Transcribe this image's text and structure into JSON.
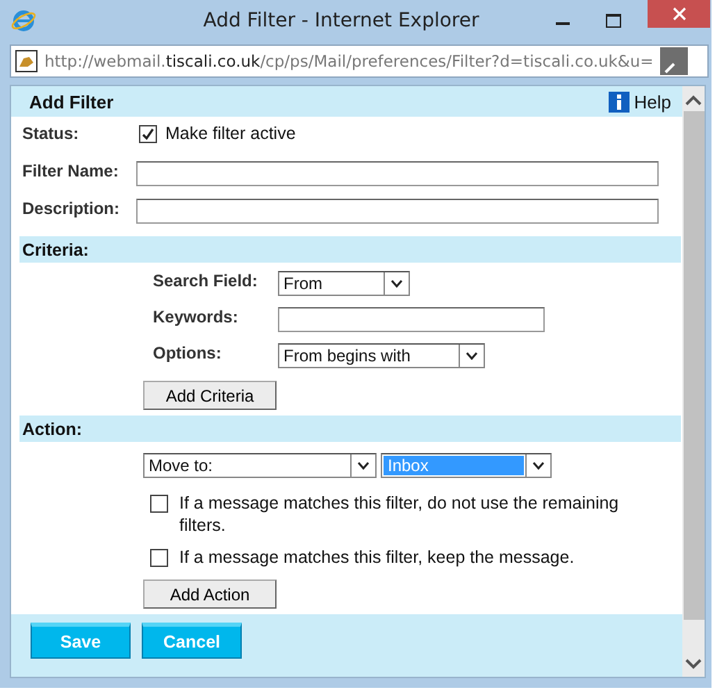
{
  "window": {
    "title": "Add Filter - Internet Explorer"
  },
  "address": {
    "prefix": "http://webmail.",
    "domain": "tiscali.co.uk",
    "path": "/cp/ps/Mail/preferences/Filter?d=tiscali.co.uk&u="
  },
  "header": {
    "title": "Add Filter",
    "help": "Help"
  },
  "status": {
    "label": "Status:",
    "checkbox": {
      "label": "Make filter active",
      "checked": true
    }
  },
  "fields": [
    {
      "label": "Filter Name:"
    },
    {
      "label": "Description:"
    }
  ],
  "criteria": {
    "title": "Criteria:",
    "search_field": {
      "label": "Search Field:",
      "value": "From"
    },
    "keywords": {
      "label": "Keywords:"
    },
    "options": {
      "label": "Options:",
      "value": "From begins with"
    },
    "button": "Add Criteria"
  },
  "action": {
    "title": "Action:",
    "action_select": {
      "value": "Move to:"
    },
    "folder_select": {
      "value": "Inbox",
      "selected": true
    },
    "options": [
      {
        "label": "If a message matches this filter, do not use the remaining filters.",
        "checked": false
      },
      {
        "label": "If a message matches this filter, keep the message.",
        "checked": false
      }
    ],
    "button": "Add Action"
  },
  "buttons": [
    "Save",
    "Cancel"
  ]
}
